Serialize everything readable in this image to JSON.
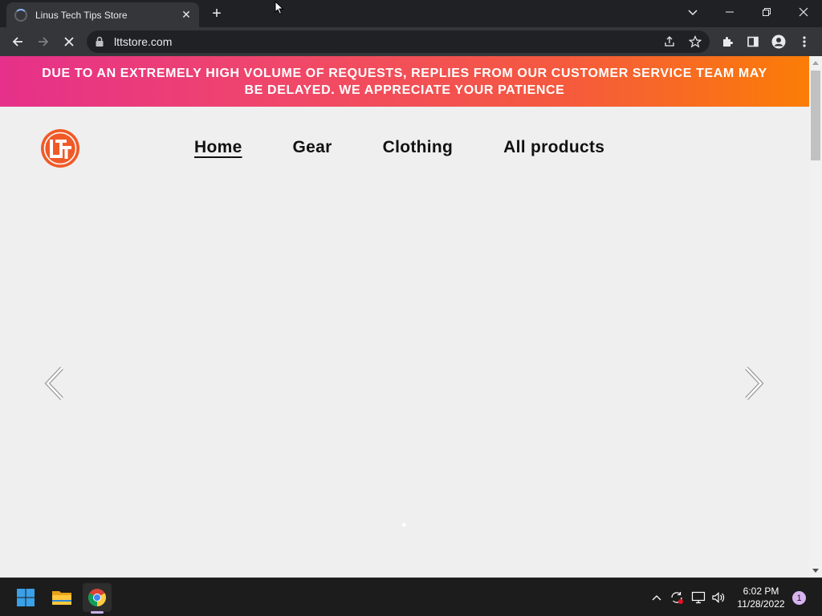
{
  "browser": {
    "tab": {
      "title": "Linus Tech Tips Store",
      "close": "✕",
      "icon": "loading-spinner-icon"
    },
    "new_tab": "+",
    "window_controls": {
      "minimize": "—",
      "restore": "❐",
      "close": "✕"
    },
    "toolbar": {
      "back_icon": "back-arrow-icon",
      "forward_icon": "forward-arrow-icon",
      "stop_icon": "stop-loading-icon",
      "url": "lttstore.com",
      "icons": [
        "share-icon",
        "bookmark-star-icon",
        "extensions-icon",
        "side-panel-icon",
        "profile-icon",
        "menu-icon"
      ]
    }
  },
  "page": {
    "banner": "DUE TO AN EXTREMELY HIGH VOLUME OF REQUESTS, REPLIES FROM OUR CUSTOMER SERVICE TEAM MAY BE DELAYED. WE APPRECIATE YOUR PATIENCE",
    "logo_text": "LTT",
    "nav": [
      {
        "label": "Home",
        "active": true
      },
      {
        "label": "Gear",
        "active": false
      },
      {
        "label": "Clothing",
        "active": false
      },
      {
        "label": "All products",
        "active": false
      }
    ],
    "carousel": {
      "slides": 1,
      "current": 1
    }
  },
  "taskbar": {
    "apps": [
      "windows-start-icon",
      "file-explorer-icon",
      "chrome-icon"
    ],
    "tray": [
      "chevron-up-icon",
      "sync-icon",
      "network-icon",
      "volume-icon"
    ],
    "time": "6:02 PM",
    "date": "11/28/2022",
    "notifications": "1"
  },
  "colors": {
    "banner_start": "#e6308a",
    "banner_end": "#fb7d06",
    "logo": "#f05a28",
    "page_bg": "#efefef",
    "browser_dark": "#202124"
  }
}
